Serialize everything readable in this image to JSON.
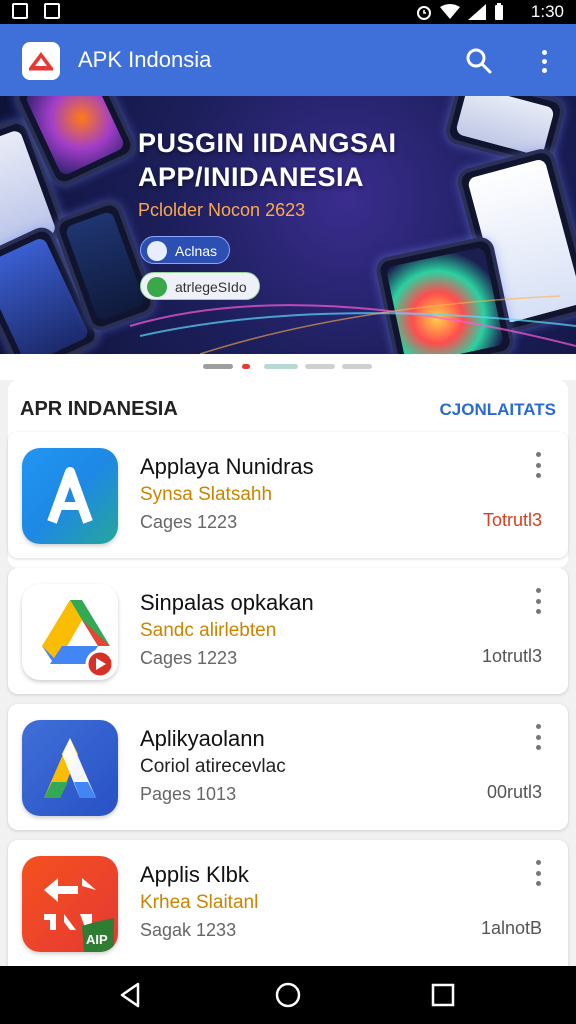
{
  "status_bar": {
    "time": "1:30"
  },
  "app_bar": {
    "title": "APK Indonsia"
  },
  "banner": {
    "headline_1": "PUSGIN IIDANGSAI",
    "headline_2": "APP/INIDANESIA",
    "subtitle": "Pclolder Nocon 2623",
    "button_1": "Aclnas",
    "button_2": "atrlegeSIdo"
  },
  "carousel": {
    "active_index": 1,
    "count": 5
  },
  "section": {
    "title": "APR INDANESIA",
    "link": "CJONLAITATS"
  },
  "apps": [
    {
      "name": "Applaya Nunidras",
      "developer": "Synsa Slatsahh",
      "meta": "Cages 1223",
      "size": "Totrutl3",
      "icon": "a-blue-icon"
    },
    {
      "name": "Sinpalas opkakan",
      "developer": "Sandc alirlebten",
      "meta": "Cages 1223",
      "size": "1otrutl3",
      "icon": "drive-icon"
    },
    {
      "name": "Aplikyaolann",
      "developer": "Coriol atirecevlac",
      "meta": "Pages 1013",
      "size": "00rutl3",
      "icon": "a-triangle-icon"
    },
    {
      "name": "Applis Klbk",
      "developer": "Krhea Slaitanl",
      "meta": "Sagak 1233",
      "size": "1alnotB",
      "icon": "apk-red-icon"
    }
  ],
  "colors": {
    "app_bar": "#3f6fd8",
    "accent_link": "#2a6bd1",
    "developer": "#c98500",
    "size_red": "#d64020"
  }
}
